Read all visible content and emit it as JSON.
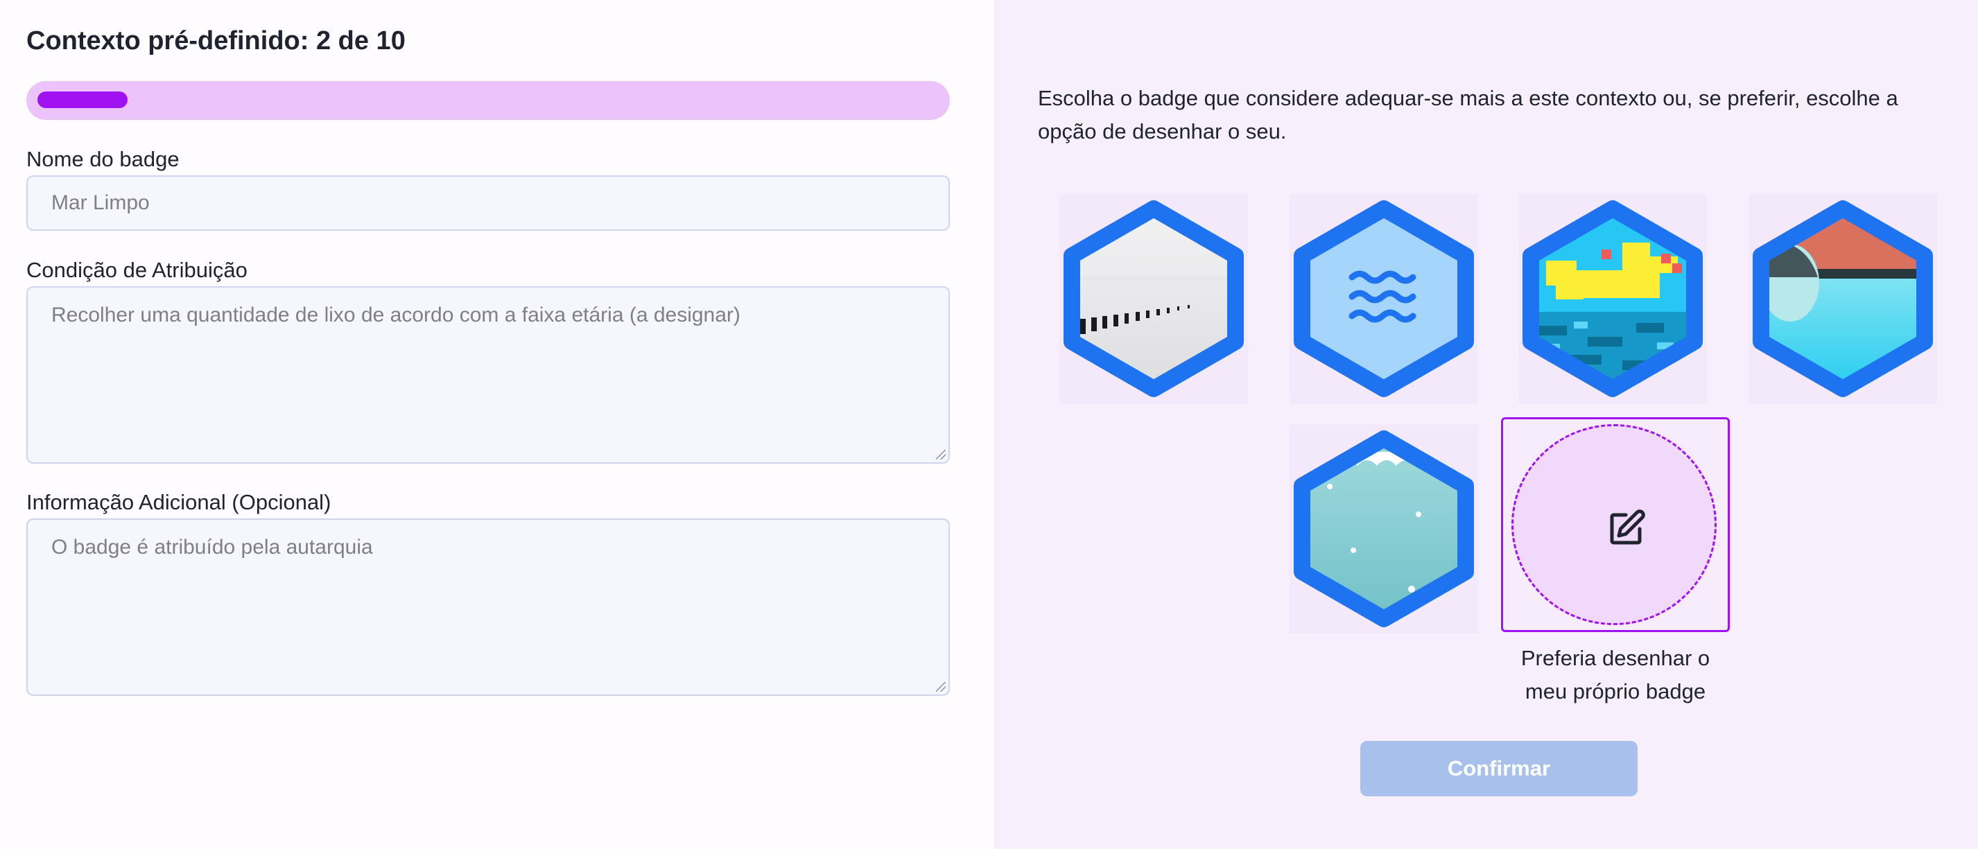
{
  "header": {
    "title": "Contexto pré-definido: 2 de 10"
  },
  "progress": {
    "current": 2,
    "total": 10,
    "fraction": 0.1,
    "track_color": "#ecc3fb",
    "fill_color": "#a012ef"
  },
  "form": {
    "name": {
      "label": "Nome do badge",
      "value": "Mar Limpo"
    },
    "condition": {
      "label": "Condição de Atribuição",
      "value": "Recolher uma quantidade de lixo de acordo com a faixa etária (a designar)"
    },
    "extra": {
      "label": "Informação Adicional (Opcional)",
      "value": "O badge é atribuído pela autarquia"
    }
  },
  "panel": {
    "instructions": "Escolha o badge que considere adequar-se mais a este contexto ou, se preferir, escolhe a opção de desenhar o seu.",
    "badges": [
      {
        "icon": "foggy-pier-image-icon"
      },
      {
        "icon": "waves-icon"
      },
      {
        "icon": "pixel-art-sea-icon"
      },
      {
        "icon": "sunset-sea-icon"
      },
      {
        "icon": "underwater-icon"
      }
    ],
    "draw_option": {
      "caption": "Preferia desenhar o meu próprio badge",
      "icon": "edit-icon",
      "selected": true
    },
    "confirm_label": "Confirmar"
  },
  "colors": {
    "accent": "#a012ef",
    "badge_border": "#1e73f0",
    "panel_bg": "#f8effd",
    "confirm_disabled": "#a8c1ec"
  }
}
